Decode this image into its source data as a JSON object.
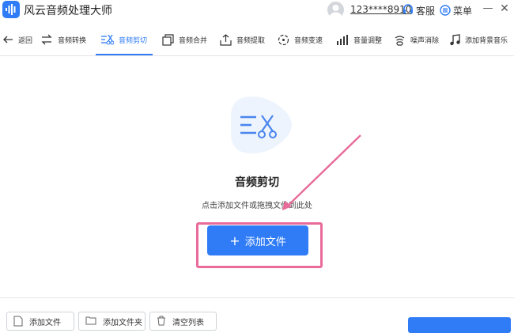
{
  "app": {
    "title": "风云音频处理大师",
    "user_id": "123****8910",
    "service_label": "客服",
    "menu_label": "菜单",
    "minimize_glyph": "—",
    "close_glyph": "✕"
  },
  "toolbar": {
    "back_label": "返回",
    "tools": [
      {
        "label": "音频转换",
        "icon": "convert-icon"
      },
      {
        "label": "音频剪切",
        "icon": "scissors-icon",
        "active": true
      },
      {
        "label": "音频合并",
        "icon": "merge-icon"
      },
      {
        "label": "音频提取",
        "icon": "extract-icon"
      },
      {
        "label": "音频变速",
        "icon": "speed-icon"
      },
      {
        "label": "音量调整",
        "icon": "volume-icon"
      },
      {
        "label": "噪声消除",
        "icon": "noise-icon"
      },
      {
        "label": "添加背景音乐",
        "icon": "music-icon"
      }
    ]
  },
  "main": {
    "title": "音频剪切",
    "hint": "点击添加文件或拖拽文件到此处",
    "add_button": "添加文件",
    "add_button_icon": "plus-icon"
  },
  "bottom": {
    "add_file": "添加文件",
    "add_folder": "添加文件夹",
    "clear_list": "清空列表"
  },
  "colors": {
    "accent": "#2f7cf6",
    "annotation": "#e86b9a"
  }
}
